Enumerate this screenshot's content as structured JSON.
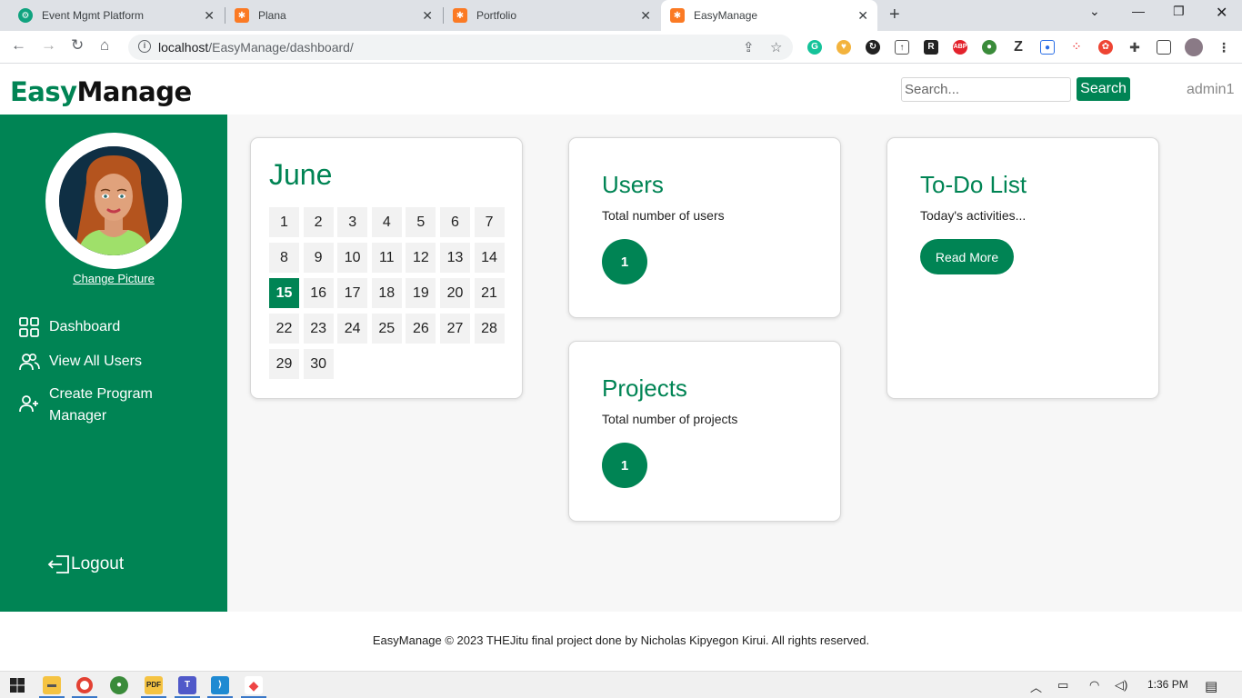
{
  "browser": {
    "tabs": [
      {
        "title": "Event Mgmt Platform",
        "icon": "chatgpt-icon",
        "active": false
      },
      {
        "title": "Plana",
        "icon": "xampp-icon",
        "active": false
      },
      {
        "title": "Portfolio",
        "icon": "xampp-icon",
        "active": false
      },
      {
        "title": "EasyManage",
        "icon": "xampp-icon",
        "active": true
      }
    ],
    "url_host": "localhost",
    "url_path": "/EasyManage/dashboard/"
  },
  "header": {
    "logo_part1": "Easy",
    "logo_part2": "Manage",
    "search_placeholder": "Search...",
    "search_button": "Search",
    "username": "admin1"
  },
  "sidebar": {
    "change_picture": "Change Picture",
    "items": [
      {
        "label": "Dashboard",
        "icon": "grid-icon"
      },
      {
        "label": "View All Users",
        "icon": "users-icon"
      },
      {
        "label": "Create Program Manager",
        "icon": "user-plus-icon"
      }
    ],
    "logout": "Logout"
  },
  "calendar": {
    "month": "June",
    "days": [
      "1",
      "2",
      "3",
      "4",
      "5",
      "6",
      "7",
      "8",
      "9",
      "10",
      "11",
      "12",
      "13",
      "14",
      "15",
      "16",
      "17",
      "18",
      "19",
      "20",
      "21",
      "22",
      "23",
      "24",
      "25",
      "26",
      "27",
      "28",
      "29",
      "30"
    ],
    "today": "15"
  },
  "users_card": {
    "title": "Users",
    "subtitle": "Total number of users",
    "count": "1"
  },
  "projects_card": {
    "title": "Projects",
    "subtitle": "Total number of projects",
    "count": "1"
  },
  "todo_card": {
    "title": "To-Do List",
    "subtitle": "Today's activities...",
    "button": "Read More"
  },
  "footer": {
    "text": "EasyManage © 2023 THEJitu final project done by Nicholas Kipyegon Kirui. All rights reserved."
  },
  "taskbar": {
    "time": "1:36 PM"
  },
  "colors": {
    "accent": "#008454",
    "background": "#f7f7f7"
  }
}
